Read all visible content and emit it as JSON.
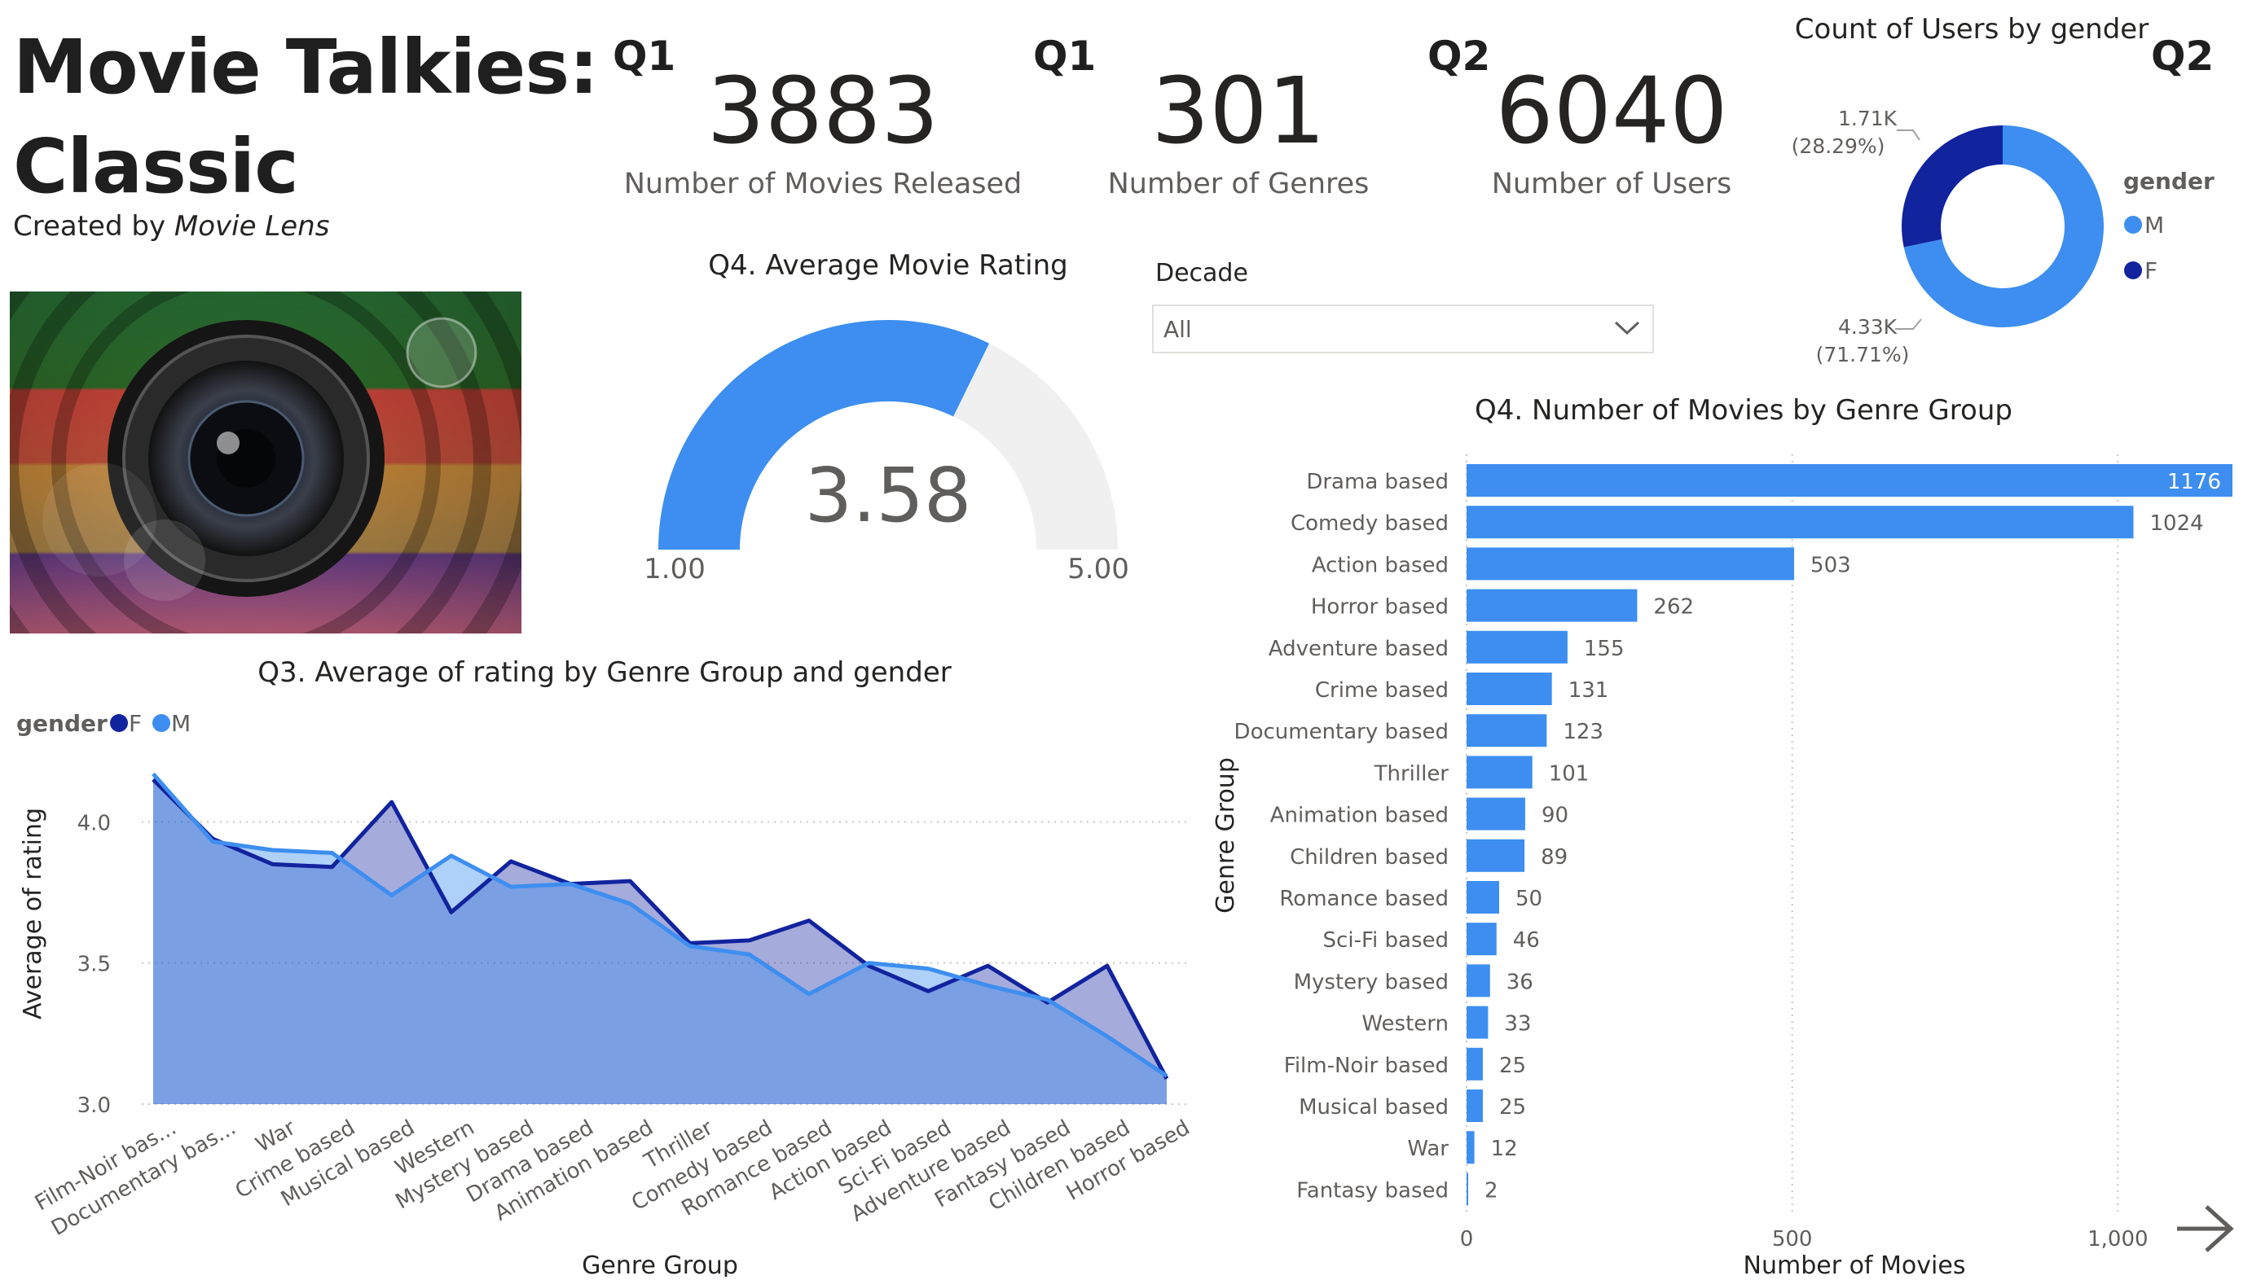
{
  "header": {
    "title_line1": "Movie Talkies:",
    "title_line2": "Classic",
    "subtitle_prefix": "Created by ",
    "subtitle_source": "Movie Lens"
  },
  "kpis": [
    {
      "tag": "Q1",
      "value": "3883",
      "label": "Number of Movies Released"
    },
    {
      "tag": "Q1",
      "value": "301",
      "label": "Number of Genres"
    },
    {
      "tag": "Q2",
      "value": "6040",
      "label": "Number of Users"
    }
  ],
  "gauge": {
    "title": "Q4. Average Movie Rating",
    "value": 3.58,
    "value_label": "3.58",
    "min": 1.0,
    "max": 5.0,
    "min_label": "1.00",
    "max_label": "5.00",
    "fill_color": "#3d8ef0",
    "track_color": "#f0f0f0"
  },
  "slicer": {
    "title": "Decade",
    "selected": "All",
    "chevron_icon": "chevron-down-icon"
  },
  "donut_tag": "Q2",
  "bar_tag_hidden": "",
  "nav": {
    "icon": "arrow-right-icon",
    "glyph": "→"
  },
  "colors": {
    "M": "#3d8ef0",
    "F": "#12239e"
  },
  "chart_data": [
    {
      "id": "donut",
      "type": "pie",
      "title": "Count of Users by gender",
      "legend_title": "gender",
      "legend_position": "right",
      "slices": [
        {
          "name": "M",
          "value": 4330,
          "label": "4.33K",
          "pct_label": "(71.71%)",
          "color": "#3d8ef0"
        },
        {
          "name": "F",
          "value": 1710,
          "label": "1.71K",
          "pct_label": "(28.29%)",
          "color": "#12239e"
        }
      ]
    },
    {
      "id": "area",
      "type": "area",
      "title": "Q3. Average of rating by Genre Group and gender",
      "xlabel": "Genre Group",
      "ylabel": "Average of rating",
      "legend_title": "gender",
      "legend_position": "top-left",
      "ylim": [
        3.0,
        4.2
      ],
      "yticks": [
        "3.0",
        "3.5",
        "4.0"
      ],
      "ytick_values": [
        3.0,
        3.5,
        4.0
      ],
      "categories": [
        "Film-Noir bas...",
        "Documentary bas...",
        "War",
        "Crime based",
        "Musical based",
        "Western",
        "Mystery based",
        "Drama based",
        "Animation based",
        "Thriller",
        "Comedy based",
        "Romance based",
        "Action based",
        "Sci-Fi based",
        "Adventure based",
        "Fantasy based",
        "Children based",
        "Horror based"
      ],
      "series": [
        {
          "name": "F",
          "color": "#12239e",
          "values": [
            4.15,
            3.94,
            3.85,
            3.84,
            4.07,
            3.68,
            3.86,
            3.78,
            3.79,
            3.57,
            3.58,
            3.65,
            3.49,
            3.4,
            3.49,
            3.36,
            3.49,
            3.09
          ]
        },
        {
          "name": "M",
          "color": "#3d8ef0",
          "values": [
            4.17,
            3.93,
            3.9,
            3.89,
            3.74,
            3.88,
            3.77,
            3.78,
            3.71,
            3.56,
            3.53,
            3.39,
            3.5,
            3.48,
            3.42,
            3.37,
            3.24,
            3.1
          ]
        }
      ],
      "grid": true
    },
    {
      "id": "bars",
      "type": "bar",
      "orientation": "horizontal",
      "title": "Q4. Number of Movies by Genre Group",
      "xlabel": "Number of Movies",
      "ylabel": "Genre Group",
      "xlim": [
        0,
        1176
      ],
      "xticks": [
        "0",
        "500",
        "1,000"
      ],
      "xtick_values": [
        0,
        500,
        1000
      ],
      "color": "#3d8ef0",
      "categories": [
        "Drama based",
        "Comedy based",
        "Action based",
        "Horror based",
        "Adventure based",
        "Crime based",
        "Documentary based",
        "Thriller",
        "Animation based",
        "Children based",
        "Romance based",
        "Sci-Fi based",
        "Mystery based",
        "Western",
        "Film-Noir based",
        "Musical based",
        "War",
        "Fantasy based"
      ],
      "values": [
        1176,
        1024,
        503,
        262,
        155,
        131,
        123,
        101,
        90,
        89,
        50,
        46,
        36,
        33,
        25,
        25,
        12,
        2
      ],
      "grid": true
    }
  ]
}
